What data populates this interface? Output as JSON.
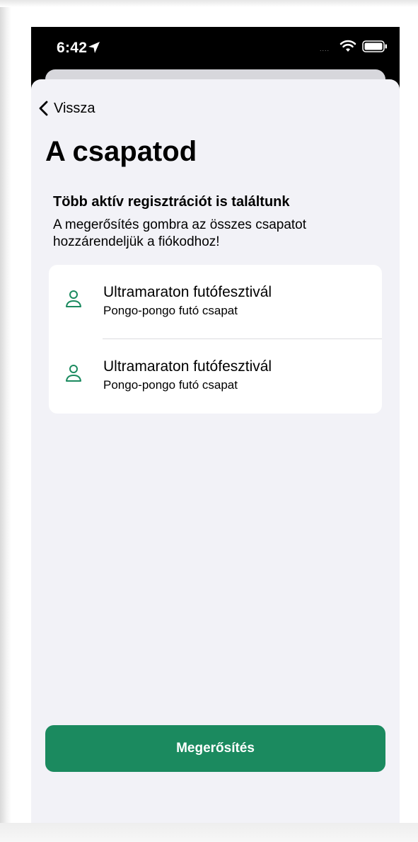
{
  "status_bar": {
    "time": "6:42",
    "signal": "....",
    "icons": [
      "location-arrow-icon",
      "wifi-icon",
      "battery-icon"
    ]
  },
  "nav": {
    "back_label": "Vissza"
  },
  "page": {
    "title": "A csapatod",
    "heading": "Több aktív regisztrációt is találtunk",
    "description": "A megerősítés gombra az összes csapatot hozzárendeljük a fiókodhoz!"
  },
  "teams": [
    {
      "event": "Ultramaraton futófesztivál",
      "team": "Pongo-pongo futó csapat",
      "icon": "person-icon"
    },
    {
      "event": "Ultramaraton futófesztivál",
      "team": "Pongo-pongo futó csapat",
      "icon": "person-icon"
    }
  ],
  "actions": {
    "confirm_label": "Megerősítés"
  },
  "colors": {
    "accent": "#1b8a5f",
    "background": "#f2f2f7",
    "card": "#ffffff"
  }
}
